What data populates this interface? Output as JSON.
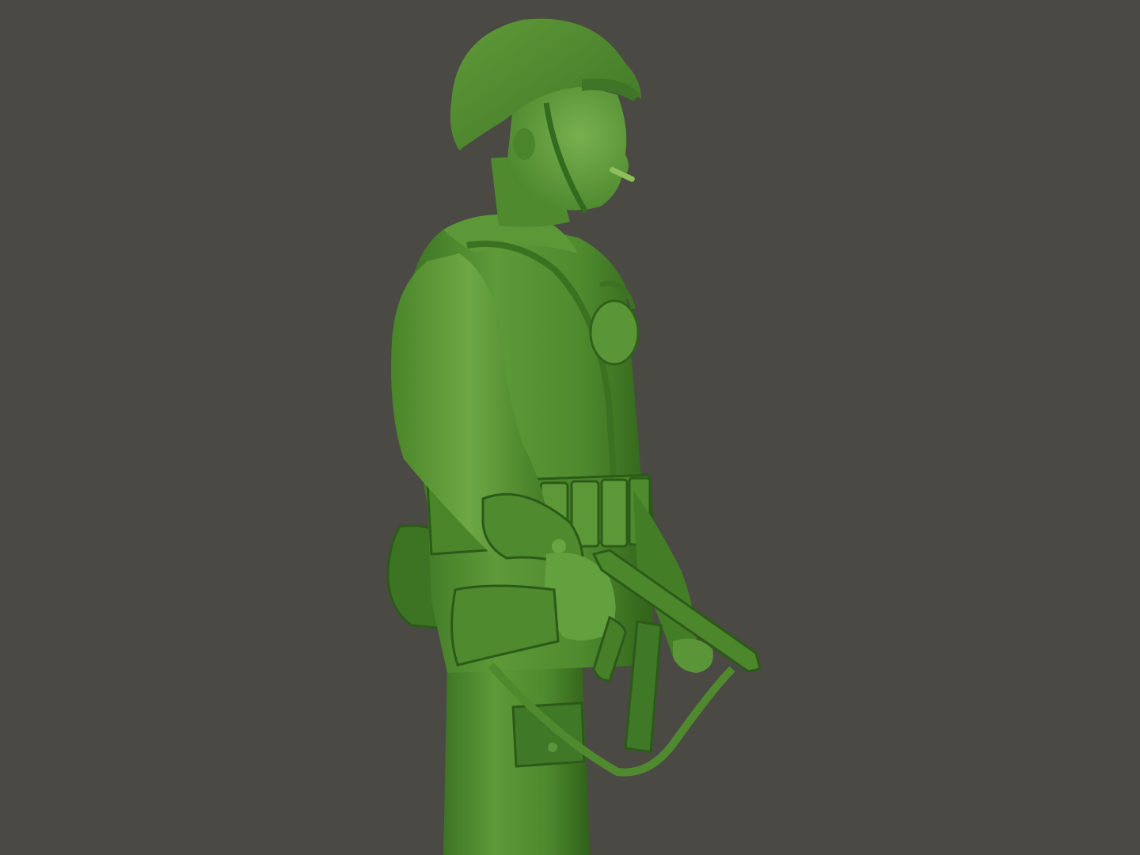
{
  "scene": {
    "subject": "green-plastic-army-soldier-figurine",
    "colors": {
      "background": "#4a4944",
      "plastic_light": "#6fa447",
      "plastic_mid": "#4f8a2e",
      "plastic_dark": "#336b1f",
      "plastic_shadow": "#244f16",
      "cigarette": "#8fbf5c"
    }
  }
}
